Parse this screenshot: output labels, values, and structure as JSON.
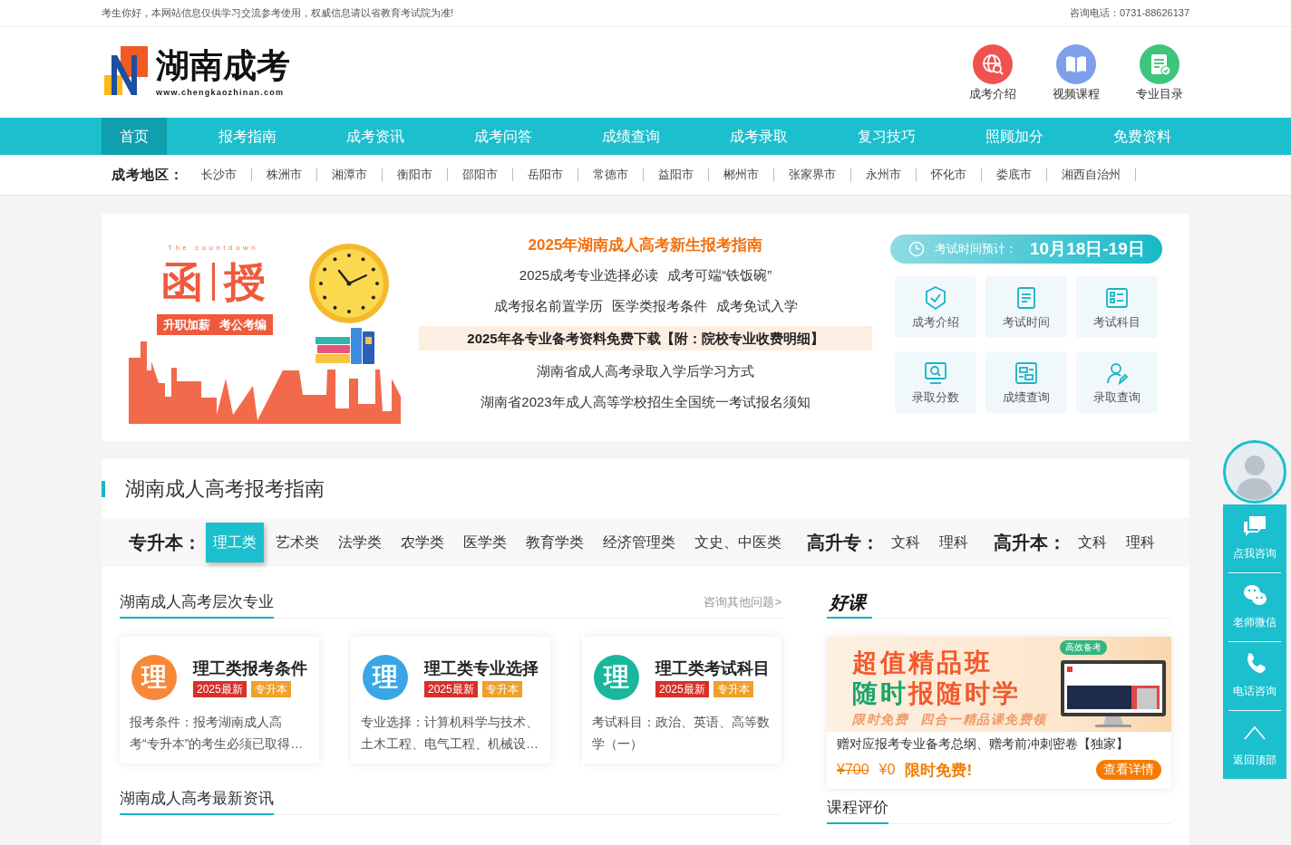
{
  "top_bar": {
    "notice": "考生你好，本网站信息仅供学习交流参考使用，权威信息请以省教育考试院为准!",
    "phone": "咨询电话：0731-88626137"
  },
  "header": {
    "logo": {
      "name": "湖南成考",
      "url": "www.chengkaozhinan.com"
    },
    "quick_links": [
      {
        "label": "成考介绍"
      },
      {
        "label": "视频课程"
      },
      {
        "label": "专业目录"
      }
    ]
  },
  "nav": {
    "items": [
      {
        "label": "首页",
        "selected": true
      },
      {
        "label": "报考指南",
        "selected": false
      },
      {
        "label": "成考资讯",
        "selected": false
      },
      {
        "label": "成考问答",
        "selected": false
      },
      {
        "label": "成绩查询",
        "selected": false
      },
      {
        "label": "成考录取",
        "selected": false
      },
      {
        "label": "复习技巧",
        "selected": false
      },
      {
        "label": "照顾加分",
        "selected": false
      },
      {
        "label": "免费资料",
        "selected": false
      }
    ]
  },
  "regions": {
    "label": "成考地区：",
    "cities": [
      "长沙市",
      "株洲市",
      "湘潭市",
      "衡阳市",
      "邵阳市",
      "岳阳市",
      "常德市",
      "益阳市",
      "郴州市",
      "张家界市",
      "永州市",
      "怀化市",
      "娄底市",
      "湘西自治州"
    ]
  },
  "banner": {
    "art": {
      "caption": "The countdown",
      "title_chars": [
        "函",
        "授"
      ],
      "slogan": "升职加薪 考公考编"
    },
    "rows": [
      {
        "kind": "headline",
        "links": [
          "2025年湖南成人高考新生报考指南"
        ]
      },
      {
        "kind": "normal",
        "links": [
          "2025成考专业选择必读",
          "成考可端“铁饭碗”"
        ]
      },
      {
        "kind": "normal",
        "links": [
          "成考报名前置学历",
          "医学类报考条件",
          "成考免试入学"
        ]
      },
      {
        "kind": "highlight",
        "links": [
          "2025年各专业备考资料免费下载【附：院校专业收费明细】"
        ]
      },
      {
        "kind": "normal",
        "links": [
          "湖南省成人高考录取入学后学习方式"
        ]
      },
      {
        "kind": "normal",
        "links": [
          "湖南省2023年成人高等学校招生全国统一考试报名须知"
        ]
      }
    ],
    "exam_time": {
      "label": "考试时间预计：",
      "value": "10月18日-19日"
    },
    "shortcuts": [
      {
        "label": "成考介绍"
      },
      {
        "label": "考试时间"
      },
      {
        "label": "考试科目"
      },
      {
        "label": "录取分数"
      },
      {
        "label": "成绩查询"
      },
      {
        "label": "录取查询"
      }
    ]
  },
  "guide": {
    "title": "湖南成人高考报考指南",
    "groups": [
      {
        "label": "专升本：",
        "tabs": [
          {
            "label": "理工类",
            "selected": true
          },
          {
            "label": "艺术类",
            "selected": false
          },
          {
            "label": "法学类",
            "selected": false
          },
          {
            "label": "农学类",
            "selected": false
          },
          {
            "label": "医学类",
            "selected": false
          },
          {
            "label": "教育学类",
            "selected": false
          },
          {
            "label": "经济管理类",
            "selected": false
          },
          {
            "label": "文史、中医类",
            "selected": false
          }
        ]
      },
      {
        "label": "高升专：",
        "tabs": [
          {
            "label": "文科",
            "selected": false
          },
          {
            "label": "理科",
            "selected": false
          }
        ]
      },
      {
        "label": "高升本：",
        "tabs": [
          {
            "label": "文科",
            "selected": false
          },
          {
            "label": "理科",
            "selected": false
          }
        ]
      }
    ],
    "majors": {
      "title": "湖南成人高考层次专业",
      "more": "咨询其他问题>",
      "cards": [
        {
          "badge": "理",
          "color": "#f7883a",
          "title": "理工类报考条件",
          "tags": [
            {
              "text": "2025最新",
              "color": "#d5312b"
            },
            {
              "text": "专升本",
              "color": "#f0a02c"
            }
          ],
          "desc": "报考条件：报考湖南成人高考“专升本”的考生必须已取得…"
        },
        {
          "badge": "理",
          "color": "#3aa6e6",
          "title": "理工类专业选择",
          "tags": [
            {
              "text": "2025最新",
              "color": "#d5312b"
            },
            {
              "text": "专升本",
              "color": "#f0a02c"
            }
          ],
          "desc": "专业选择：计算机科学与技术、土木工程、电气工程、机械设…"
        },
        {
          "badge": "理",
          "color": "#19b79c",
          "title": "理工类考试科目",
          "tags": [
            {
              "text": "2025最新",
              "color": "#d5312b"
            },
            {
              "text": "专升本",
              "color": "#f0a02c"
            }
          ],
          "desc": "考试科目：政治、英语、高等数学（一）"
        }
      ]
    },
    "news": {
      "title": "湖南成人高考最新资讯"
    },
    "courses": {
      "title": "好课",
      "banner": {
        "badge": "高效备考",
        "line1": "超值精品班",
        "line2": [
          {
            "text": "随时",
            "kind": "accent"
          },
          {
            "text": "报随时学",
            "kind": "main"
          }
        ],
        "tagline": "限时免费 四合一精品课免费领"
      },
      "desc": "赠对应报考专业备考总纲、赠考前冲刺密卷【独家】",
      "old_price": "¥700",
      "price": "¥0",
      "promo": "限时免费!",
      "button": "查看详情"
    },
    "reviews": {
      "title": "课程评价"
    }
  },
  "float_bar": {
    "items": [
      {
        "label": "点我咨询"
      },
      {
        "label": "老师微信"
      },
      {
        "label": "电话咨询"
      },
      {
        "label": "返回顶部"
      }
    ]
  }
}
